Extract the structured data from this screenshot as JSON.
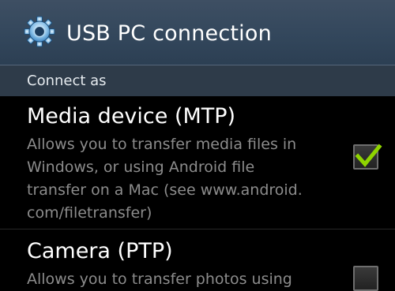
{
  "title_bar": {
    "icon": "gear-icon",
    "title": "USB PC connection"
  },
  "section": {
    "header": "Connect as"
  },
  "options": [
    {
      "title": "Media device (MTP)",
      "description_lines": [
        "Allows you to transfer media files in",
        "Windows, or using Android file",
        "transfer on a Mac (see www.android.",
        "com/filetransfer)"
      ],
      "checked": true
    },
    {
      "title": "Camera (PTP)",
      "description_lines": [
        "Allows you to transfer photos using"
      ],
      "checked": false
    }
  ],
  "colors": {
    "accent_check": "#8fd400",
    "title_bar": "#33475c",
    "section_header": "#2e3b49",
    "background": "#000000",
    "description_text": "#8c8c8c"
  }
}
